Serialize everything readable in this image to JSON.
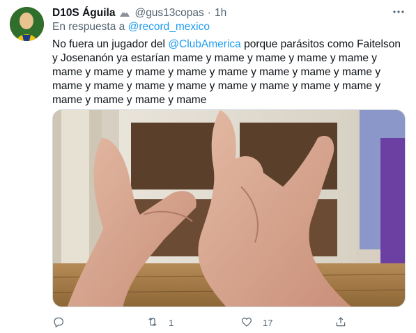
{
  "tweet": {
    "author": {
      "name": "D10S Águila",
      "handle": "@gus13copas",
      "separator": "·",
      "time": "1h"
    },
    "reply_to": {
      "prefix": "En respuesta a",
      "handle": "@record_mexico"
    },
    "text": {
      "part1": "No fuera un jugador del ",
      "mention": "@ClubAmerica",
      "part2": " porque parásitos como Faitelson y Josenanón ya estarían mame y mame y mame y mame y mame y mame y mame y mame y mame y mame y mame y mame y mame y mame y mame y mame y mame y mame y mame y mame y mame y mame y mame y mame y mame"
    },
    "actions": {
      "reply_count": "",
      "retweet_count": "1",
      "like_count": "17",
      "share_count": ""
    },
    "icons": {
      "verified": "mountain-emoji-icon",
      "more": "more-dots-icon",
      "reply": "reply-icon",
      "retweet": "retweet-icon",
      "like": "heart-icon",
      "share": "share-icon"
    },
    "colors": {
      "link": "#1d9bf0",
      "secondary": "#536471"
    }
  }
}
